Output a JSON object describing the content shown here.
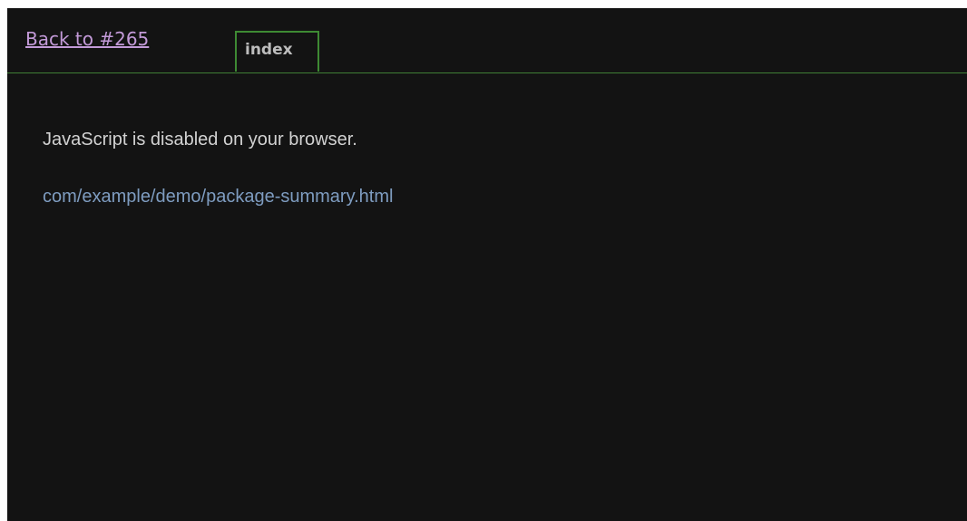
{
  "header": {
    "back_link": "Back to #265",
    "tab_label": "index"
  },
  "main": {
    "message": "JavaScript is disabled on your browser.",
    "link_text": "com/example/demo/package-summary.html"
  },
  "colors": {
    "background": "#131313",
    "accent_green": "#3e8a33",
    "back_link": "#c39ad8",
    "link": "#7e9cc0",
    "text": "#d2d2d2"
  }
}
